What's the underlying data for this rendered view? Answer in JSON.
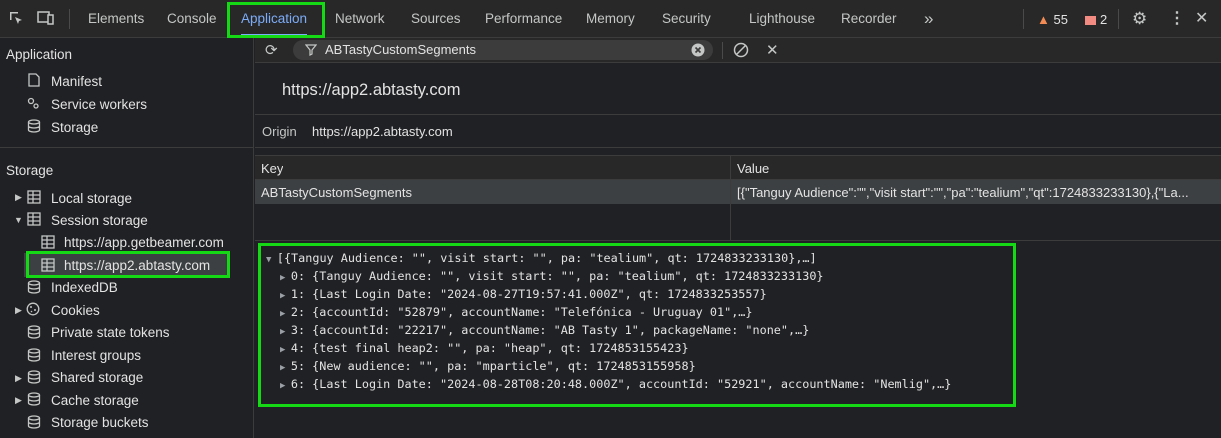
{
  "tabs": [
    "Elements",
    "Console",
    "Application",
    "Network",
    "Sources",
    "Performance",
    "Memory",
    "Security",
    "Lighthouse",
    "Recorder"
  ],
  "more_tabs": "»",
  "warnings_count": "55",
  "errors_count": "2",
  "sidebar": {
    "application_header": "Application",
    "application_items": [
      "Manifest",
      "Service workers",
      "Storage"
    ],
    "storage_header": "Storage",
    "local_storage": "Local storage",
    "session_storage": "Session storage",
    "session_children": [
      "https://app.getbeamer.com",
      "https://app2.abtasty.com"
    ],
    "storage_items": [
      "IndexedDB",
      "Cookies",
      "Private state tokens",
      "Interest groups",
      "Shared storage",
      "Cache storage",
      "Storage buckets"
    ]
  },
  "filter": {
    "value": "ABTastyCustomSegments"
  },
  "origin_title": "https://app2.abtasty.com",
  "origin_label": "Origin",
  "origin_value": "https://app2.abtasty.com",
  "table": {
    "headers": [
      "Key",
      "Value"
    ],
    "rows": [
      {
        "key": "ABTastyCustomSegments",
        "value": "[{\"Tanguy Audience\":\"\",\"visit start\":\"\",\"pa\":\"tealium\",\"qt\":1724833233130},{\"La..."
      }
    ]
  },
  "preview": {
    "root": "[{Tanguy Audience: \"\", visit start: \"\", pa: \"tealium\", qt: 1724833233130},…]",
    "items": [
      "0: {Tanguy Audience: \"\", visit start: \"\", pa: \"tealium\", qt: 1724833233130}",
      "1: {Last Login Date: \"2024-08-27T19:57:41.000Z\", qt: 1724833253557}",
      "2: {accountId: \"52879\", accountName: \"Telefónica - Uruguay 01\",…}",
      "3: {accountId: \"22217\", accountName: \"AB Tasty 1\", packageName: \"none\",…}",
      "4: {test final heap2: \"\", pa: \"heap\", qt: 1724853155423}",
      "5: {New audience: \"\", pa: \"mparticle\", qt: 1724853155958}",
      "6: {Last Login Date: \"2024-08-28T08:20:48.000Z\", accountId: \"52921\", accountName: \"Nemlig\",…}"
    ]
  },
  "colors": {
    "highlight": "#16d916",
    "accent": "#7cacf8",
    "background": "#202124"
  }
}
